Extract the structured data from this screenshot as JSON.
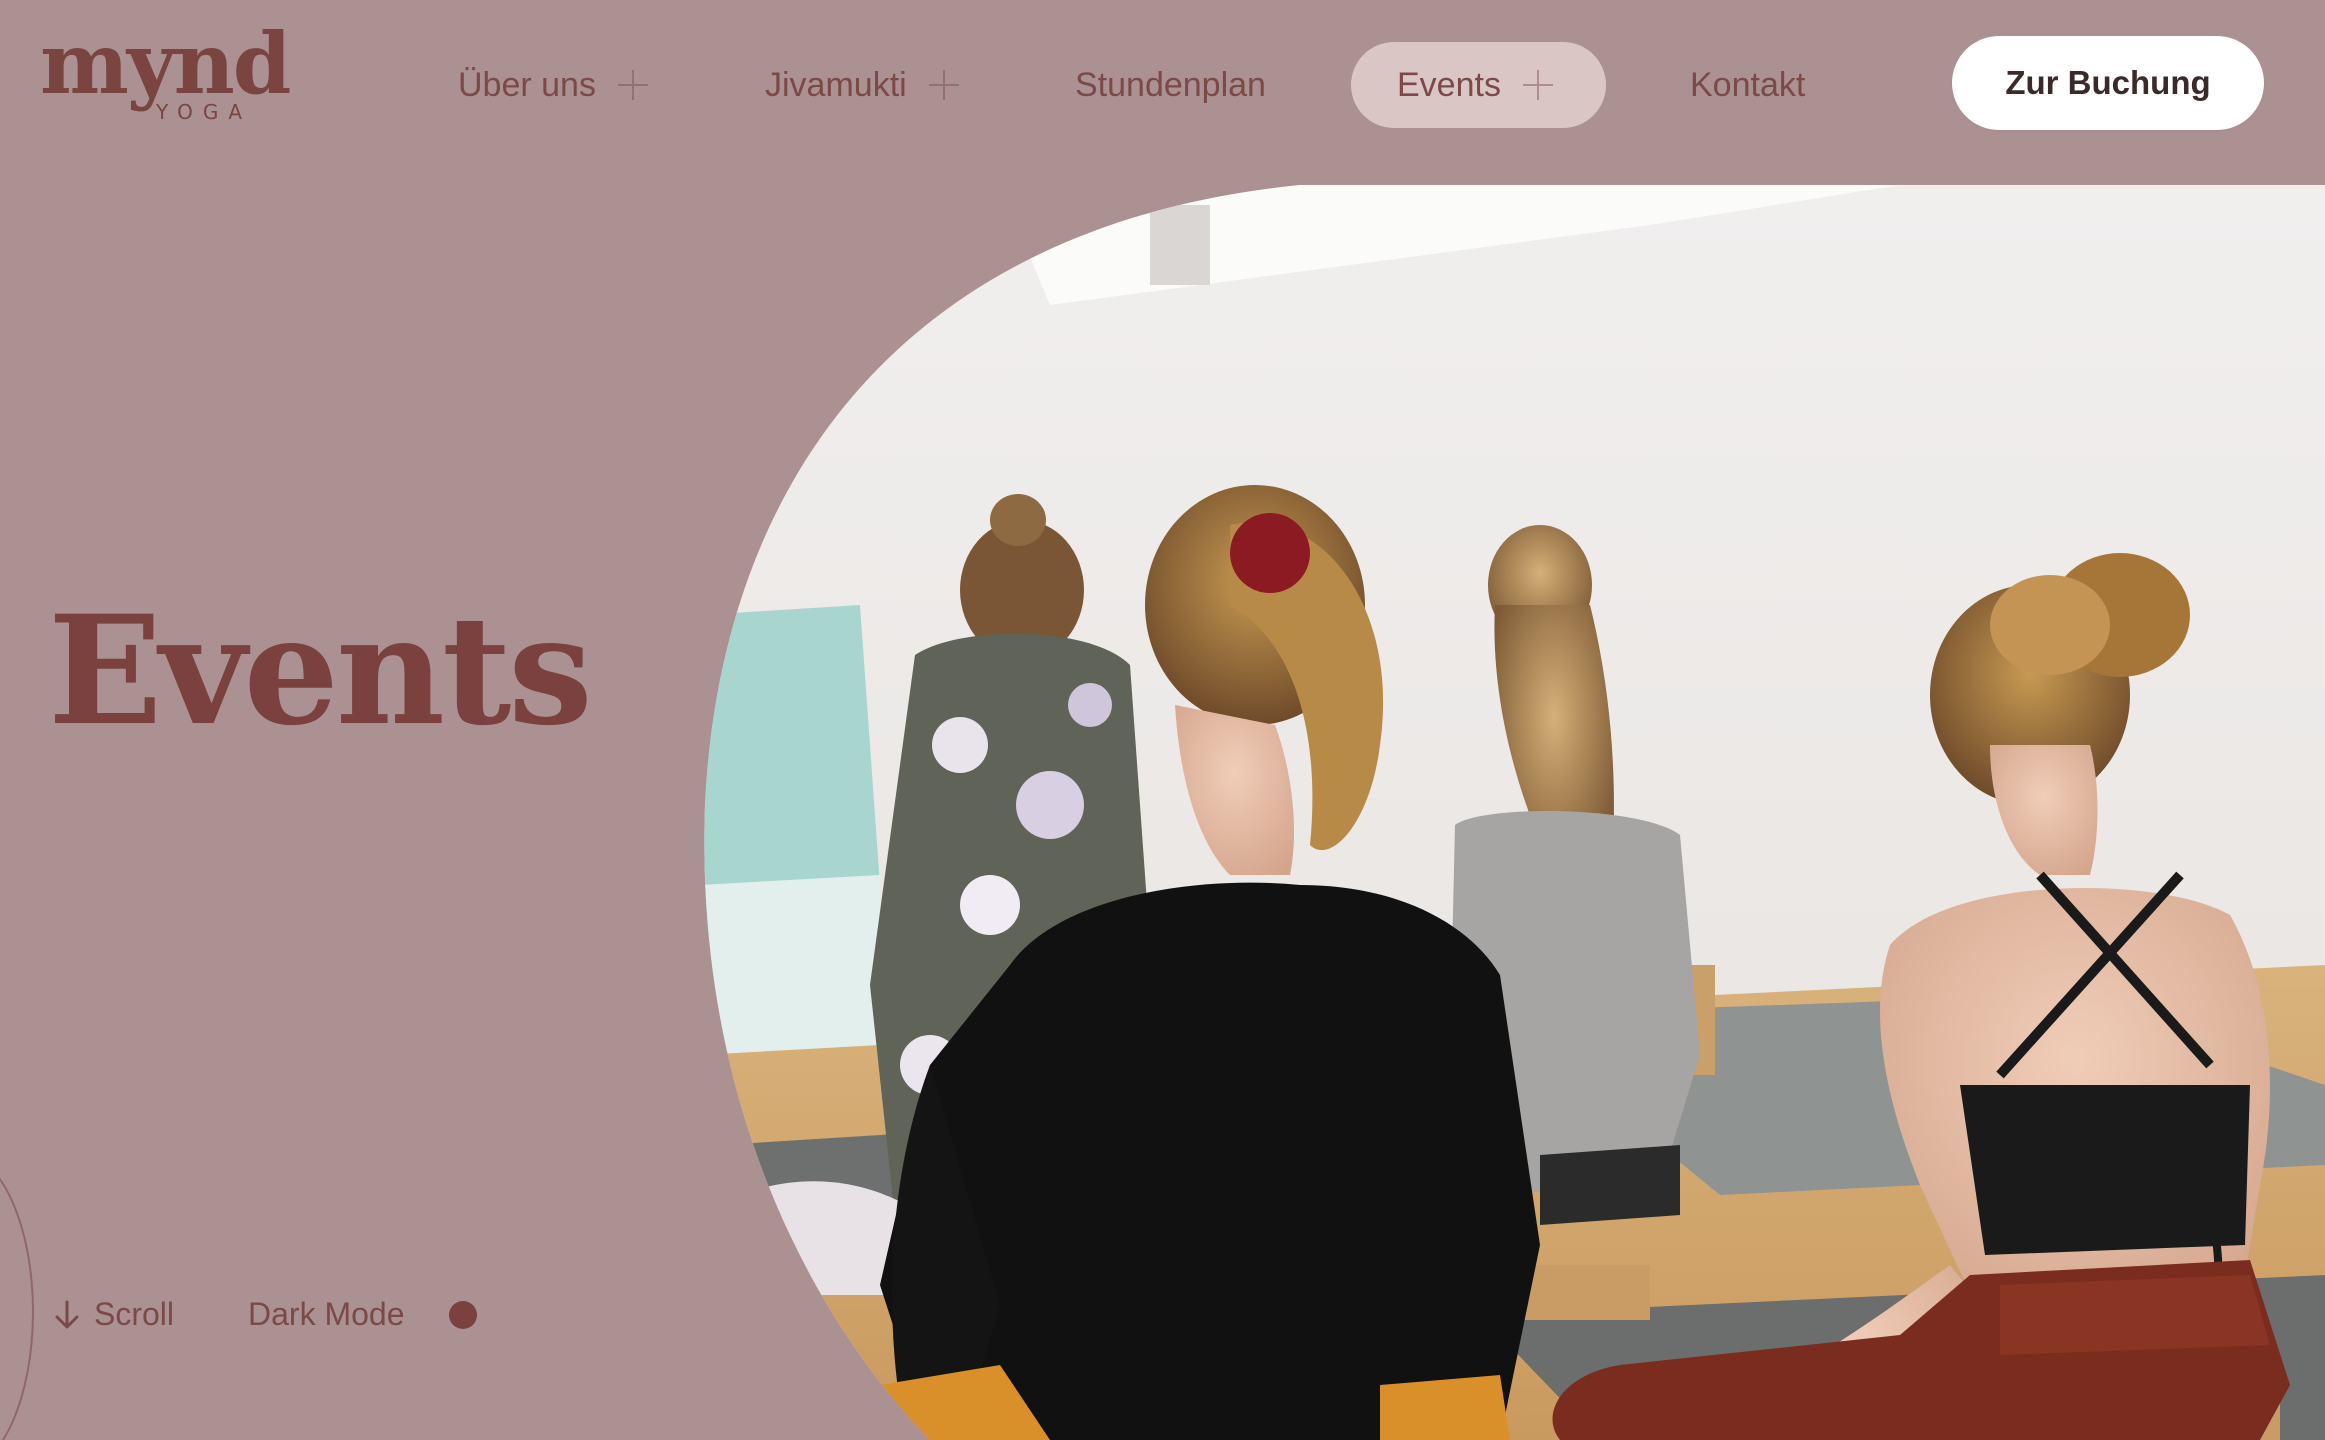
{
  "brand": {
    "name": "mynd",
    "tagline": "YOGA"
  },
  "nav": {
    "items": [
      {
        "label": "Über uns",
        "has_submenu": true
      },
      {
        "label": "Jivamukti",
        "has_submenu": true
      },
      {
        "label": "Stundenplan",
        "has_submenu": false
      },
      {
        "label": "Events",
        "has_submenu": true,
        "active": true
      },
      {
        "label": "Kontakt",
        "has_submenu": false
      }
    ],
    "cta_label": "Zur Buchung"
  },
  "hero": {
    "title": "Events",
    "image_subject": "yoga-class-seated-meditation-photo"
  },
  "footer_controls": {
    "scroll_label": "Scroll",
    "dark_mode_label": "Dark Mode",
    "dark_mode_on": false
  },
  "colors": {
    "background": "#ac9193",
    "brand": "#7a413e",
    "active_pill": "#dbc6c6",
    "cta_background": "#ffffff"
  },
  "icons": {
    "submenu": "plus-icon",
    "scroll": "arrow-down-icon",
    "dark_mode": "dot-toggle-icon"
  }
}
